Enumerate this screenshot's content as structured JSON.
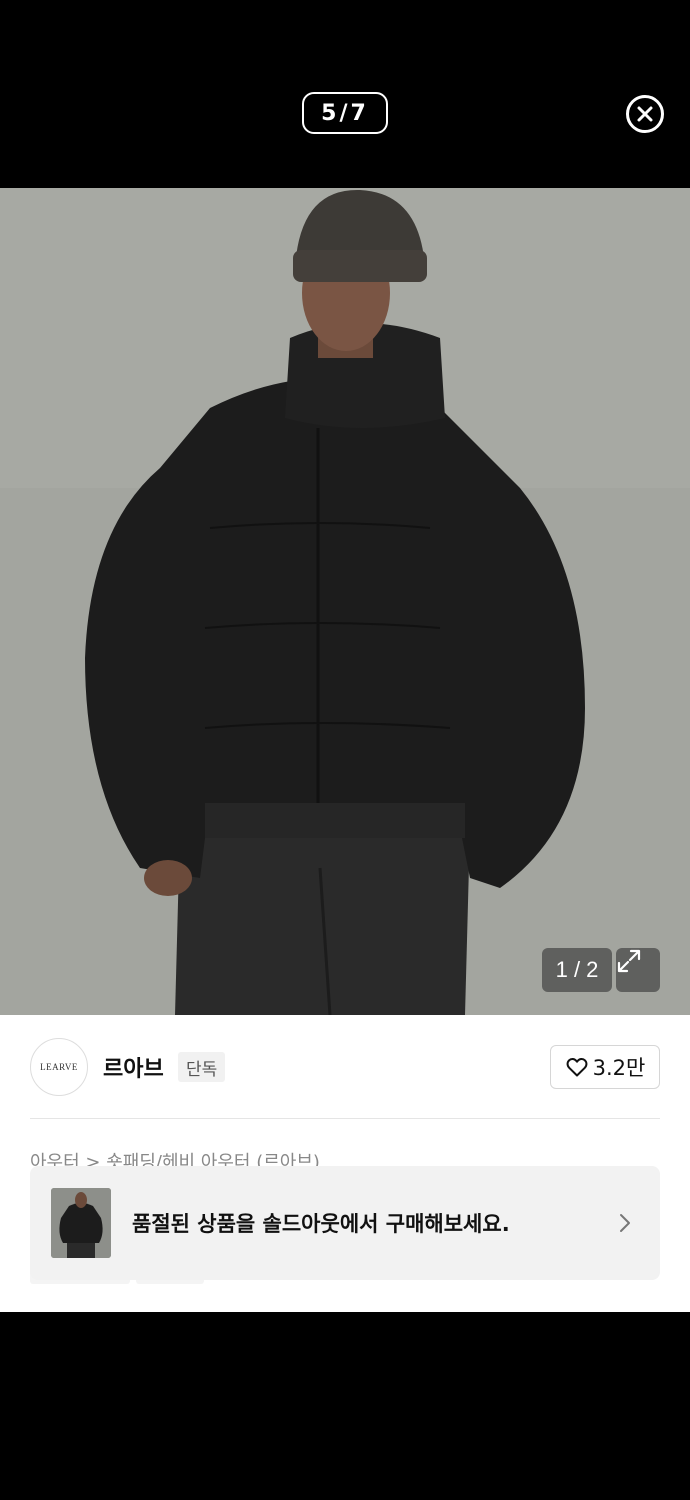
{
  "viewer": {
    "counter": "5/7",
    "close_icon": "close-circle-icon"
  },
  "product": {
    "image_counter": "1 / 2",
    "expand_icon": "expand-icon"
  },
  "brand": {
    "logo_text": "LEARVE",
    "name": "르아브",
    "badge": "단독",
    "like_count": "3.2만"
  },
  "breadcrumb": "아우터 > 숏패딩/헤비 아우터 (르아브)",
  "banner": {
    "text": "품절된 상품을 솔드아웃에서 구매해보세요.",
    "chevron_icon": "chevron-right-icon"
  },
  "colors": {
    "background": "#000000",
    "card": "#ffffff",
    "banner_bg": "#f2f2f2"
  }
}
